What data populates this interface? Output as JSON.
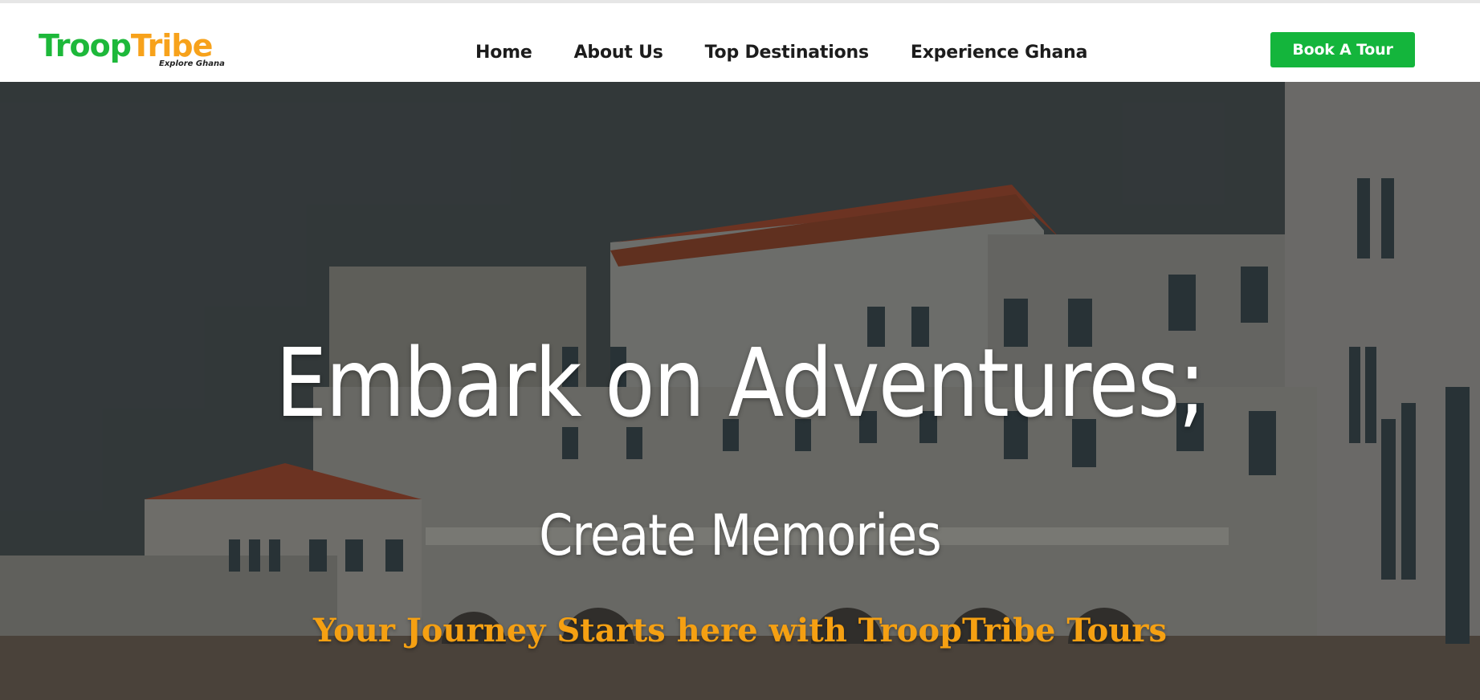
{
  "brand": {
    "name_part1": "Troop",
    "name_part2": "Tribe",
    "tagline": "Explore Ghana",
    "colors": {
      "green": "#1db83a",
      "orange": "#f7a21b"
    }
  },
  "nav": {
    "items": [
      {
        "label": "Home"
      },
      {
        "label": "About Us"
      },
      {
        "label": "Top Destinations"
      },
      {
        "label": "Experience Ghana"
      }
    ]
  },
  "cta": {
    "label": "Book A Tour",
    "color": "#14b53c"
  },
  "hero": {
    "title": "Embark on Adventures;",
    "subtitle": "Create Memories",
    "tagline": "Your Journey Starts here with TroopTribe Tours",
    "tagline_color": "#f5a012",
    "background_image": "white colonial castle with red tiled roofs under a grey sky"
  }
}
